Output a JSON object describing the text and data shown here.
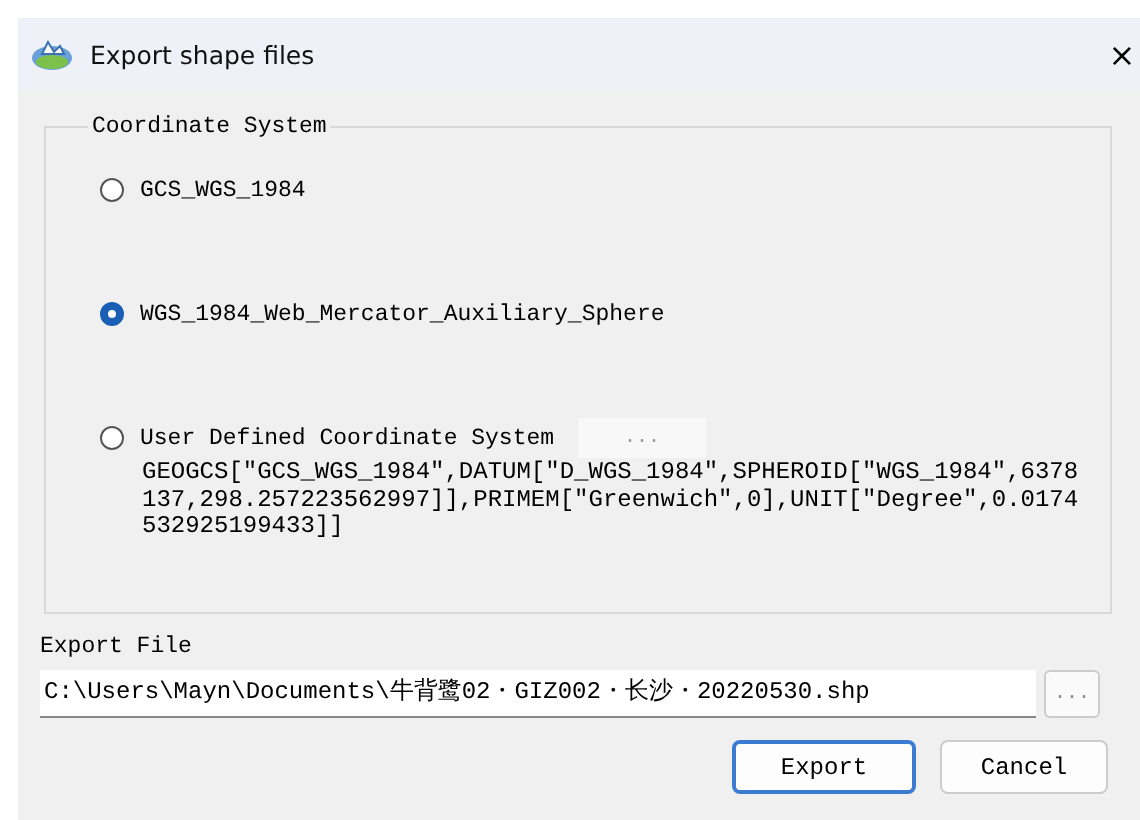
{
  "window": {
    "title": "Export shape files",
    "close": "×"
  },
  "coordinate_system": {
    "title": "Coordinate System",
    "options": [
      {
        "label": "GCS_WGS_1984",
        "selected": false
      },
      {
        "label": "WGS_1984_Web_Mercator_Auxiliary_Sphere",
        "selected": true
      },
      {
        "label": "User Defined Coordinate System",
        "selected": false,
        "browse": "...",
        "definition": "GEOGCS[\"GCS_WGS_1984\",DATUM[\"D_WGS_1984\",SPHEROID[\"WGS_1984\",6378137,298.257223562997]],PRIMEM[\"Greenwich\",0],UNIT[\"Degree\",0.0174532925199433]]"
      }
    ]
  },
  "export_file": {
    "label": "Export File",
    "value": "C:\\Users\\Mayn\\Documents\\牛背鹭02・GIZ002・长沙・20220530.shp",
    "browse": "..."
  },
  "buttons": [
    {
      "label": "Export",
      "kind": "default"
    },
    {
      "label": "Cancel",
      "kind": "normal"
    }
  ]
}
